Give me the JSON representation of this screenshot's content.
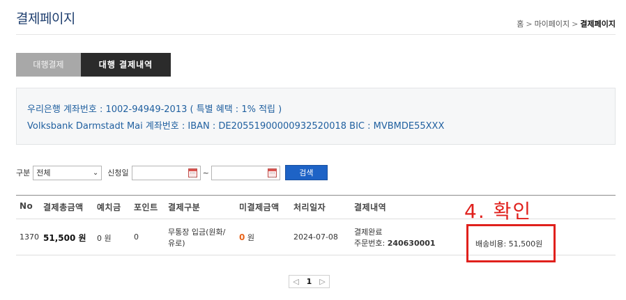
{
  "header": {
    "title": "결제페이지",
    "breadcrumb": [
      "홈",
      "마이페이지",
      "결제페이지"
    ],
    "separator": ">"
  },
  "tabs": [
    {
      "label": "대행결제",
      "active": false
    },
    {
      "label": "대행 결제내역",
      "active": true
    }
  ],
  "account": {
    "line1": "우리은행  계좌번호 : 1002-94949-2013  ( 특별 혜택 : 1% 적립 )",
    "line2": "Volksbank Darmstadt Mai  계좌번호 : IBAN : DE20551900000932520018  BIC : MVBMDE55XXX"
  },
  "filter": {
    "type_label": "구분",
    "type_value": "전체",
    "date_label": "신청일",
    "date_from": "",
    "date_to": "",
    "range_sep": "~",
    "search_label": "검색"
  },
  "table": {
    "headers": [
      "No",
      "결제총금액",
      "예치금",
      "포인트",
      "결제구분",
      "미결제금액",
      "처리일자",
      "결제내역"
    ],
    "rows": [
      {
        "no": "1370",
        "total": "51,500 원",
        "deposit": "0 원",
        "points": "0",
        "method_line1": "무통장 입금(원화/",
        "method_line2": "유로)",
        "unpaid_amount": "0",
        "unpaid_unit": "원",
        "date": "2024-07-08",
        "status": "결제완료",
        "order_label": "주문번호:",
        "order_no": "240630001",
        "shipping": "배송비용: 51,500원"
      }
    ]
  },
  "annotation": {
    "label": "4. 확인",
    "color": "#e0201c"
  },
  "pagination": {
    "prev": "◁",
    "current": "1",
    "next": "▷"
  }
}
